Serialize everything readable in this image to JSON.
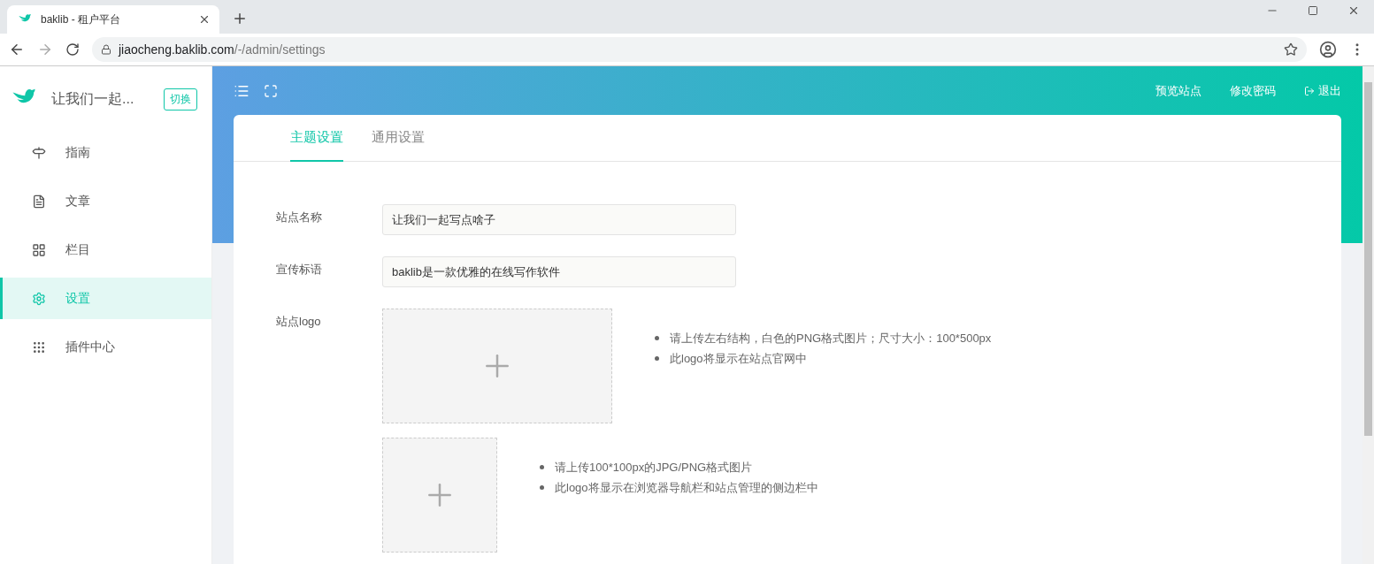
{
  "browser": {
    "tab_title": "baklib - 租户平台",
    "url_host": "jiaocheng.baklib.com",
    "url_path": "/-/admin/settings"
  },
  "sidebar": {
    "site_name": "让我们一起...",
    "switch_button": "切换",
    "items": [
      {
        "label": "指南",
        "selected": false
      },
      {
        "label": "文章",
        "selected": false
      },
      {
        "label": "栏目",
        "selected": false
      },
      {
        "label": "设置",
        "selected": true
      },
      {
        "label": "插件中心",
        "selected": false
      }
    ]
  },
  "header": {
    "links": [
      {
        "label": "预览站点",
        "kind": "text"
      },
      {
        "label": "修改密码",
        "kind": "text"
      },
      {
        "label": "退出",
        "kind": "logout"
      }
    ]
  },
  "tabs": [
    {
      "label": "主题设置",
      "selected": true
    },
    {
      "label": "通用设置",
      "selected": false
    }
  ],
  "form": {
    "fields": [
      {
        "label": "站点名称",
        "value": "让我们一起写点啥子"
      },
      {
        "label": "宣传标语",
        "value": "baklib是一款优雅的在线写作软件"
      }
    ],
    "logo_label": "站点logo",
    "uploads": [
      {
        "kind": "wide",
        "hints": [
          "请上传左右结构，白色的PNG格式图片；尺寸大小：100*500px",
          "此logo将显示在站点官网中"
        ]
      },
      {
        "kind": "square",
        "hints": [
          "请上传100*100px的JPG/PNG格式图片",
          "此logo将显示在浏览器导航栏和站点管理的侧边栏中"
        ]
      }
    ]
  }
}
